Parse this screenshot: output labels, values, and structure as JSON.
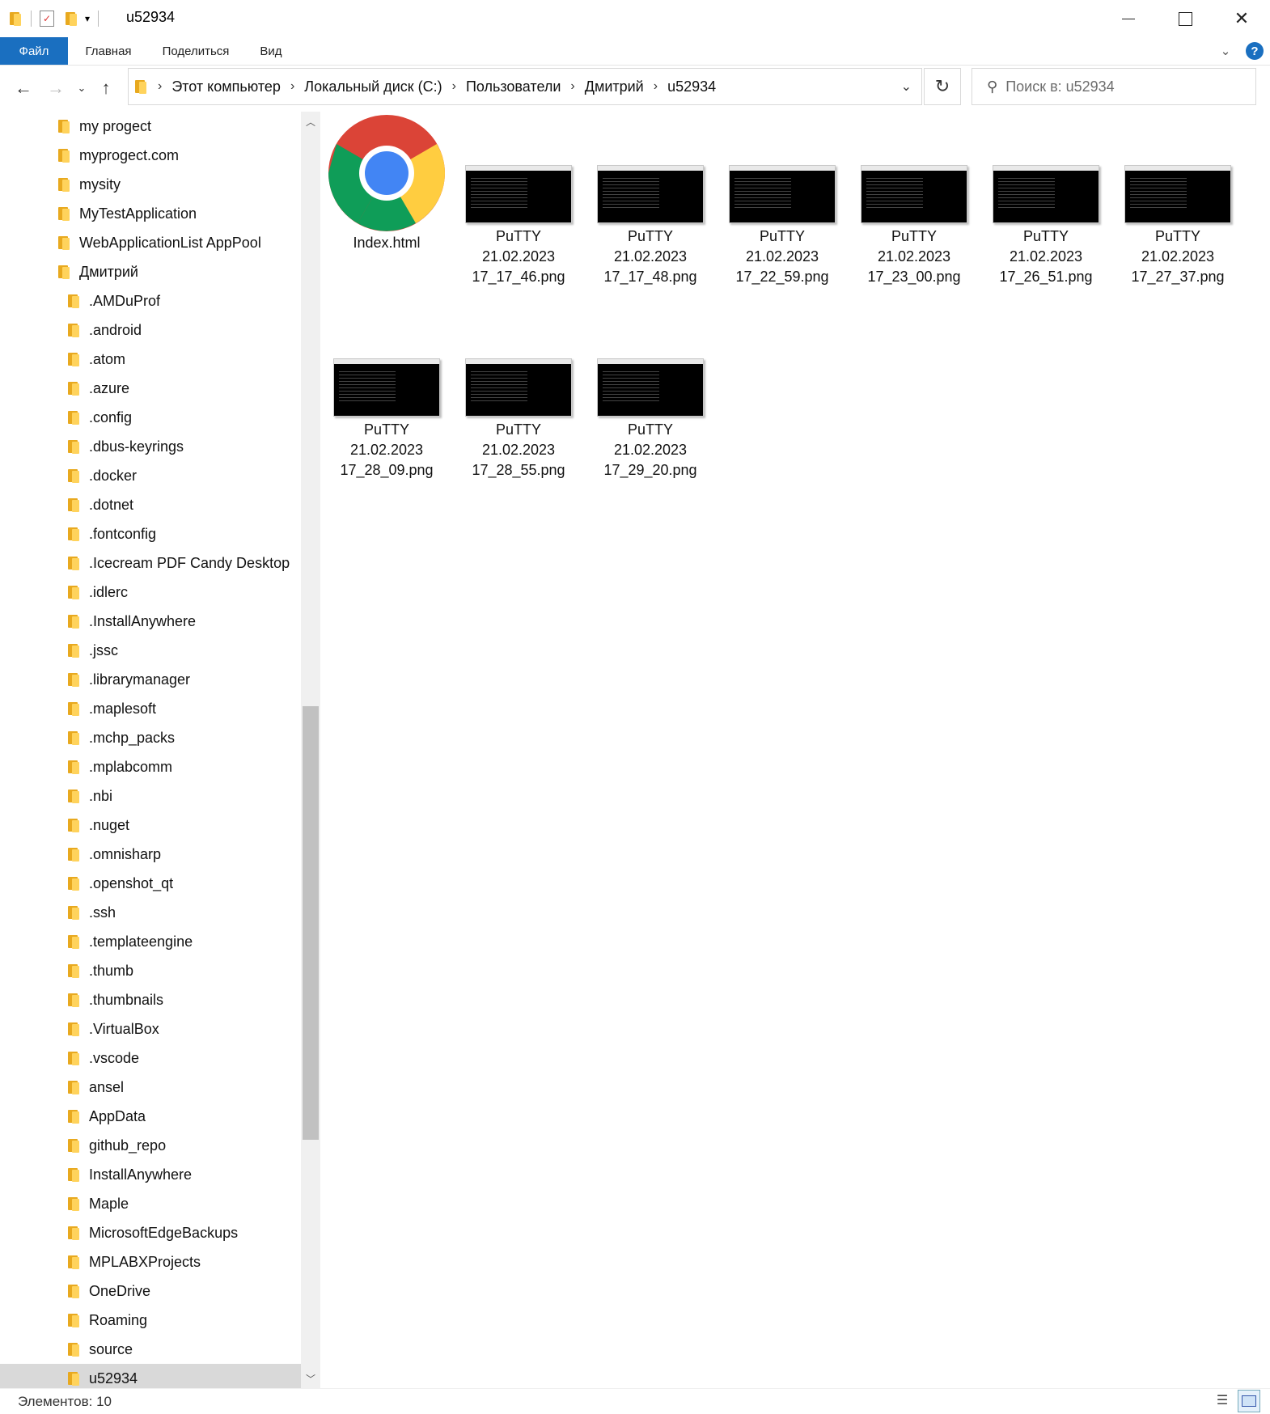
{
  "window": {
    "title": "u52934",
    "minimize_icon": "minimize-icon",
    "maximize_icon": "maximize-icon",
    "close_icon": "close-icon"
  },
  "ribbon": {
    "tabs": [
      "Файл",
      "Главная",
      "Поделиться",
      "Вид"
    ]
  },
  "address": {
    "crumbs": [
      "Этот компьютер",
      "Локальный диск (C:)",
      "Пользователи",
      "Дмитрий",
      "u52934"
    ]
  },
  "search": {
    "placeholder": "Поиск в: u52934"
  },
  "tree": [
    {
      "label": "my progect"
    },
    {
      "label": "myprogect.com"
    },
    {
      "label": "mysity"
    },
    {
      "label": "MyTestApplication"
    },
    {
      "label": "WebApplicationList AppPool"
    },
    {
      "label": "Дмитрий"
    },
    {
      "label": ".AMDuProf"
    },
    {
      "label": ".android"
    },
    {
      "label": ".atom"
    },
    {
      "label": ".azure"
    },
    {
      "label": ".config"
    },
    {
      "label": ".dbus-keyrings"
    },
    {
      "label": ".docker"
    },
    {
      "label": ".dotnet"
    },
    {
      "label": ".fontconfig"
    },
    {
      "label": ".Icecream PDF Candy Desktop"
    },
    {
      "label": ".idlerc"
    },
    {
      "label": ".InstallAnywhere"
    },
    {
      "label": ".jssc"
    },
    {
      "label": ".librarymanager"
    },
    {
      "label": ".maplesoft"
    },
    {
      "label": ".mchp_packs"
    },
    {
      "label": ".mplabcomm"
    },
    {
      "label": ".nbi"
    },
    {
      "label": ".nuget"
    },
    {
      "label": ".omnisharp"
    },
    {
      "label": ".openshot_qt"
    },
    {
      "label": ".ssh"
    },
    {
      "label": ".templateengine"
    },
    {
      "label": ".thumb"
    },
    {
      "label": ".thumbnails"
    },
    {
      "label": ".VirtualBox"
    },
    {
      "label": ".vscode"
    },
    {
      "label": "ansel"
    },
    {
      "label": "AppData"
    },
    {
      "label": "github_repo"
    },
    {
      "label": "InstallAnywhere"
    },
    {
      "label": "Maple"
    },
    {
      "label": "MicrosoftEdgeBackups"
    },
    {
      "label": "MPLABXProjects"
    },
    {
      "label": "OneDrive"
    },
    {
      "label": "Roaming"
    },
    {
      "label": "source"
    },
    {
      "label": "u52934"
    }
  ],
  "files": [
    {
      "line1": "Index.html",
      "line2": "",
      "line3": "",
      "icon": "chrome-icon"
    },
    {
      "line1": "PuTTY",
      "line2": "21.02.2023",
      "line3": "17_17_46.png"
    },
    {
      "line1": "PuTTY",
      "line2": "21.02.2023",
      "line3": "17_17_48.png"
    },
    {
      "line1": "PuTTY",
      "line2": "21.02.2023",
      "line3": "17_22_59.png"
    },
    {
      "line1": "PuTTY",
      "line2": "21.02.2023",
      "line3": "17_23_00.png"
    },
    {
      "line1": "PuTTY",
      "line2": "21.02.2023",
      "line3": "17_26_51.png"
    },
    {
      "line1": "PuTTY",
      "line2": "21.02.2023",
      "line3": "17_27_37.png"
    },
    {
      "line1": "PuTTY",
      "line2": "21.02.2023",
      "line3": "17_28_09.png"
    },
    {
      "line1": "PuTTY",
      "line2": "21.02.2023",
      "line3": "17_28_55.png"
    },
    {
      "line1": "PuTTY",
      "line2": "21.02.2023",
      "line3": "17_29_20.png"
    }
  ],
  "status": {
    "items_count": "Элементов: 10"
  },
  "colors": {
    "accent": "#1a6fc0",
    "folder": "#ffd35c"
  }
}
